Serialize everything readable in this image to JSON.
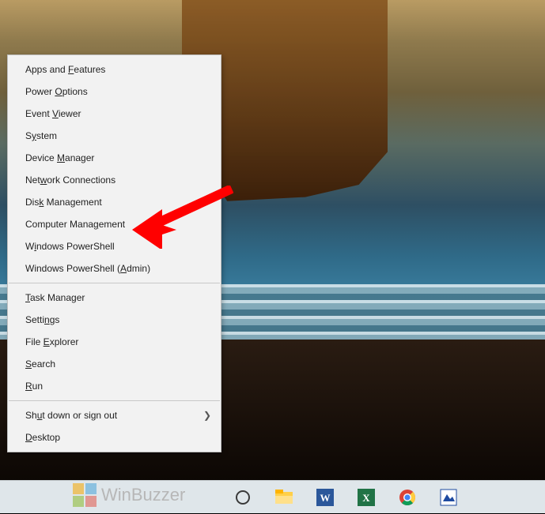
{
  "winx": {
    "groups": [
      [
        {
          "key": "apps-and-features",
          "pre": "Apps and ",
          "mn": "F",
          "post": "eatures"
        },
        {
          "key": "power-options",
          "pre": "Power ",
          "mn": "O",
          "post": "ptions"
        },
        {
          "key": "event-viewer",
          "pre": "Event ",
          "mn": "V",
          "post": "iewer"
        },
        {
          "key": "system",
          "pre": "S",
          "mn": "y",
          "post": "stem"
        },
        {
          "key": "device-manager",
          "pre": "Device ",
          "mn": "M",
          "post": "anager"
        },
        {
          "key": "network-connections",
          "pre": "Net",
          "mn": "w",
          "post": "ork Connections"
        },
        {
          "key": "disk-management",
          "pre": "Dis",
          "mn": "k",
          "post": " Management"
        },
        {
          "key": "computer-management",
          "pre": "Computer Mana",
          "mn": "g",
          "post": "ement"
        },
        {
          "key": "windows-powershell",
          "pre": "W",
          "mn": "i",
          "post": "ndows PowerShell"
        },
        {
          "key": "windows-powershell-admin",
          "pre": "Windows PowerShell (",
          "mn": "A",
          "post": "dmin)"
        }
      ],
      [
        {
          "key": "task-manager",
          "pre": "",
          "mn": "T",
          "post": "ask Manager"
        },
        {
          "key": "settings",
          "pre": "Setti",
          "mn": "n",
          "post": "gs"
        },
        {
          "key": "file-explorer",
          "pre": "File ",
          "mn": "E",
          "post": "xplorer"
        },
        {
          "key": "search",
          "pre": "",
          "mn": "S",
          "post": "earch"
        },
        {
          "key": "run",
          "pre": "",
          "mn": "R",
          "post": "un"
        }
      ],
      [
        {
          "key": "shut-down-or-sign-out",
          "pre": "Sh",
          "mn": "u",
          "post": "t down or sign out",
          "submenu": true
        },
        {
          "key": "desktop",
          "pre": "",
          "mn": "D",
          "post": "esktop"
        }
      ]
    ]
  },
  "taskbar": {
    "icons": [
      "cortana",
      "file-explorer",
      "word",
      "excel",
      "chrome",
      "paint-app"
    ]
  },
  "watermark": {
    "text": "WinBuzzer"
  },
  "annotation": {
    "target": "computer-management"
  }
}
